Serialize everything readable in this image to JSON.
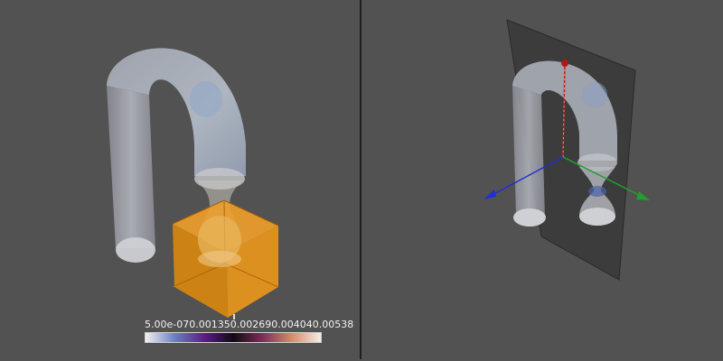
{
  "viewports": {
    "left": {
      "colorbar": {
        "tick_labels": [
          "5.00e-07",
          "0.00135",
          "0.00269",
          "0.00404",
          "0.00538"
        ],
        "gradient_colors": [
          "#f2f2f2",
          "#6a7fc0",
          "#5a1e8a",
          "#120a12",
          "#7a2d5a",
          "#d88a6a",
          "#f2eee6"
        ]
      },
      "box_color": "#e08a10"
    },
    "right": {
      "plane_color": "#3c3c3c",
      "axes": {
        "x_color": "#2030d0",
        "y_color": "#c02020",
        "z_color": "#20a030"
      }
    }
  },
  "background_color": "#525252"
}
